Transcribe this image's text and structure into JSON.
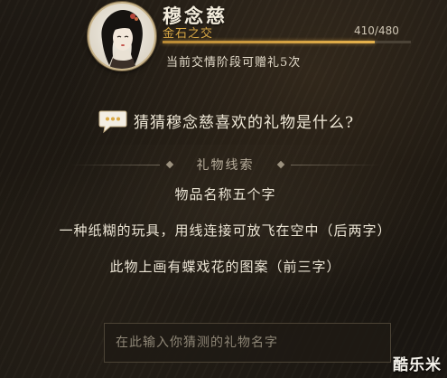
{
  "character": {
    "name": "穆念慈",
    "relation": "金石之交",
    "affinity_current": 410,
    "affinity_max": 480,
    "affinity_text": "410/480",
    "affinity_fraction": 0.854,
    "gift_note": "当前交情阶段可赠礼5次"
  },
  "question": {
    "text": "猜猜穆念慈喜欢的礼物是什么?",
    "icon": "speech-bubble-icon"
  },
  "clues": {
    "title": "礼物线索",
    "items": [
      "物品名称五个字",
      "一种纸糊的玩具，用线连接可放飞在空中（后两字）",
      "此物上画有蝶戏花的图案（前三字）"
    ]
  },
  "guess": {
    "placeholder": "在此输入你猜测的礼物名字",
    "value": ""
  },
  "watermark": "酷乐米",
  "colors": {
    "accent_gold": "#d9a845",
    "bar_fill": "#e6b24d",
    "background": "#1c1712",
    "text": "#ece5d5"
  }
}
